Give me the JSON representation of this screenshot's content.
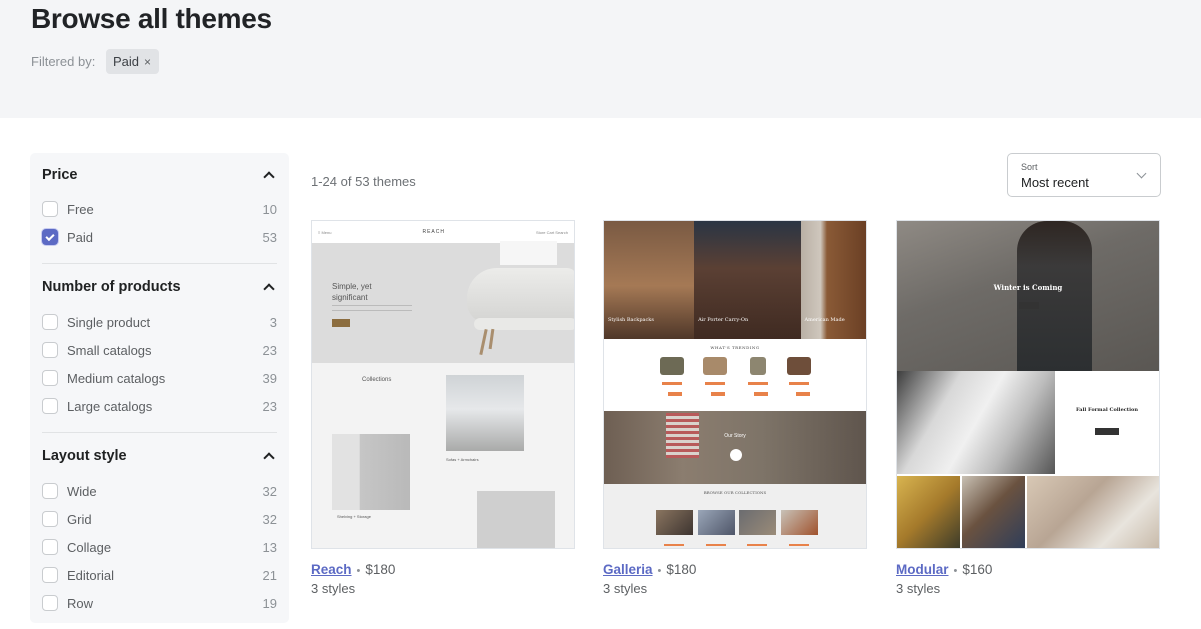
{
  "header": {
    "title": "Browse all themes",
    "filtered_by_label": "Filtered by:",
    "active_filter": {
      "label": "Paid",
      "remove_icon": "×"
    }
  },
  "sidebar": {
    "groups": [
      {
        "title": "Price",
        "expanded": true,
        "options": [
          {
            "label": "Free",
            "count": "10",
            "checked": false
          },
          {
            "label": "Paid",
            "count": "53",
            "checked": true
          }
        ]
      },
      {
        "title": "Number of products",
        "expanded": true,
        "options": [
          {
            "label": "Single product",
            "count": "3",
            "checked": false
          },
          {
            "label": "Small catalogs",
            "count": "23",
            "checked": false
          },
          {
            "label": "Medium catalogs",
            "count": "39",
            "checked": false
          },
          {
            "label": "Large catalogs",
            "count": "23",
            "checked": false
          }
        ]
      },
      {
        "title": "Layout style",
        "expanded": true,
        "options": [
          {
            "label": "Wide",
            "count": "32",
            "checked": false
          },
          {
            "label": "Grid",
            "count": "32",
            "checked": false
          },
          {
            "label": "Collage",
            "count": "13",
            "checked": false
          },
          {
            "label": "Editorial",
            "count": "21",
            "checked": false
          },
          {
            "label": "Row",
            "count": "19",
            "checked": false
          }
        ]
      }
    ]
  },
  "results": {
    "count_text": "1-24 of 53 themes",
    "sort": {
      "label": "Sort",
      "value": "Most recent"
    }
  },
  "themes": [
    {
      "name": "Reach",
      "price": "$180",
      "styles": "3 styles",
      "preview": {
        "logo": "REACH",
        "menu": "≡ Menu",
        "nav_right": "Store  Cart  Search",
        "hero_title": "Simple, yet significant",
        "section_title": "Collections",
        "captions": [
          "Sofas + Armchairs",
          "Shelving + Storage"
        ]
      }
    },
    {
      "name": "Galleria",
      "price": "$180",
      "styles": "3 styles",
      "preview": {
        "hero_captions": [
          "Stylish Backpacks",
          "Air Porter Carry-On",
          "American Made"
        ],
        "trending_title": "WHAT'S TRENDING",
        "story_title": "Our Story",
        "browse_title": "BROWSE OUR COLLECTIONS"
      }
    },
    {
      "name": "Modular",
      "price": "$160",
      "styles": "3 styles",
      "preview": {
        "hero_title": "Winter is Coming",
        "feature_title": "Fall Formal Collection"
      }
    }
  ],
  "colors": {
    "accent": "#5c6ac4",
    "hero_bg": "#f4f5f7",
    "sidebar_bg": "#f6f7f9"
  }
}
